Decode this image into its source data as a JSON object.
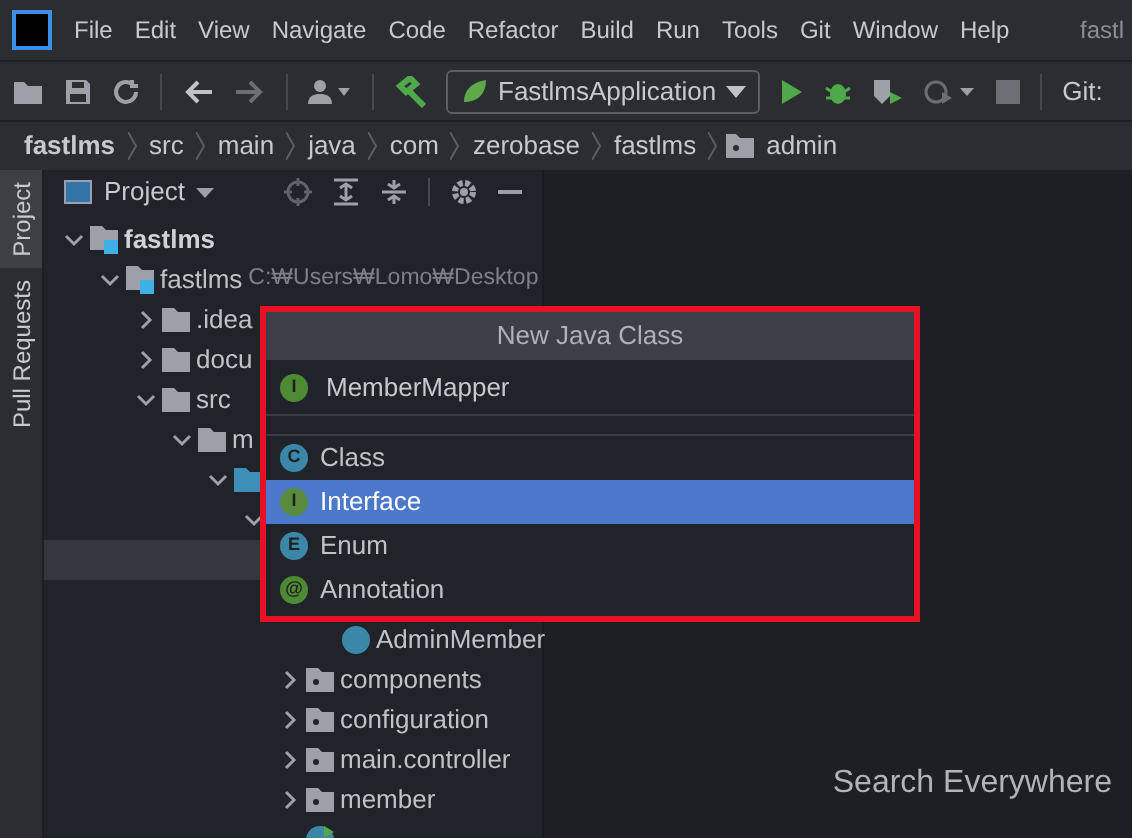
{
  "menu_bar": {
    "items": [
      "File",
      "Edit",
      "View",
      "Navigate",
      "Code",
      "Refactor",
      "Build",
      "Run",
      "Tools",
      "Git",
      "Window",
      "Help"
    ],
    "title": "fastl"
  },
  "toolbar": {
    "run_config": "FastlmsApplication",
    "git_label": "Git:"
  },
  "breadcrumbs": [
    {
      "label": "fastlms",
      "kind": "root"
    },
    {
      "label": "src",
      "kind": "plain"
    },
    {
      "label": "main",
      "kind": "plain"
    },
    {
      "label": "java",
      "kind": "plain"
    },
    {
      "label": "com",
      "kind": "plain"
    },
    {
      "label": "zerobase",
      "kind": "plain"
    },
    {
      "label": "fastlms",
      "kind": "plain"
    },
    {
      "label": "admin",
      "kind": "package"
    }
  ],
  "side_tabs": [
    {
      "label": "Project",
      "selected": true
    },
    {
      "label": "Pull Requests",
      "selected": false
    }
  ],
  "project_panel": {
    "title": "Project",
    "tree": [
      {
        "label": "fastlms",
        "kind": "module",
        "expanded": true,
        "selected": false,
        "bold": true,
        "children": [
          {
            "label": "fastlms",
            "path": "C:₩Users₩Lomo₩Desktop",
            "kind": "module",
            "expanded": true,
            "selected": false,
            "children": [
              {
                "label": ".idea",
                "kind": "folder",
                "expanded": false,
                "selected": false
              },
              {
                "label": "docu",
                "kind": "folder",
                "expanded": false,
                "selected": false
              },
              {
                "label": "src",
                "kind": "folder",
                "expanded": true,
                "selected": false,
                "children": [
                  {
                    "label": "m",
                    "kind": "folder",
                    "expanded": true,
                    "selected": false,
                    "children": [
                      {
                        "kind": "source",
                        "expanded": true,
                        "selected": false,
                        "children": [
                          {
                            "expanded": true,
                            "selected": false,
                            "children": [
                              {
                                "selected": true,
                                "children": [
                                  {
                                    "selected": false
                                  },
                                  {
                                    "label": "AdminMember",
                                    "kind": "class",
                                    "selected": false
                                  }
                                ]
                              },
                              {
                                "label": "components",
                                "kind": "package",
                                "expanded": false,
                                "selected": false
                              },
                              {
                                "label": "configuration",
                                "kind": "package",
                                "expanded": false,
                                "selected": false
                              },
                              {
                                "label": "main.controller",
                                "kind": "package",
                                "expanded": false,
                                "selected": false
                              },
                              {
                                "label": "member",
                                "kind": "package",
                                "expanded": false,
                                "selected": false
                              },
                              {
                                "kind": "app",
                                "selected": false
                              }
                            ]
                          }
                        ]
                      }
                    ]
                  }
                ]
              }
            ]
          }
        ]
      }
    ]
  },
  "editor": {
    "hint": "Search Everywhere"
  },
  "popup": {
    "title": "New Java Class",
    "name_value": "MemberMapper",
    "name_badge": "I",
    "options": [
      {
        "label": "Class",
        "badge": "C",
        "color": "#3b87a8",
        "selected": false
      },
      {
        "label": "Interface",
        "badge": "I",
        "color": "#5a8a3c",
        "selected": true
      },
      {
        "label": "Enum",
        "badge": "E",
        "color": "#3b87a8",
        "selected": false
      },
      {
        "label": "Annotation",
        "badge": "@",
        "color": "#4e8a32",
        "selected": false
      }
    ]
  }
}
